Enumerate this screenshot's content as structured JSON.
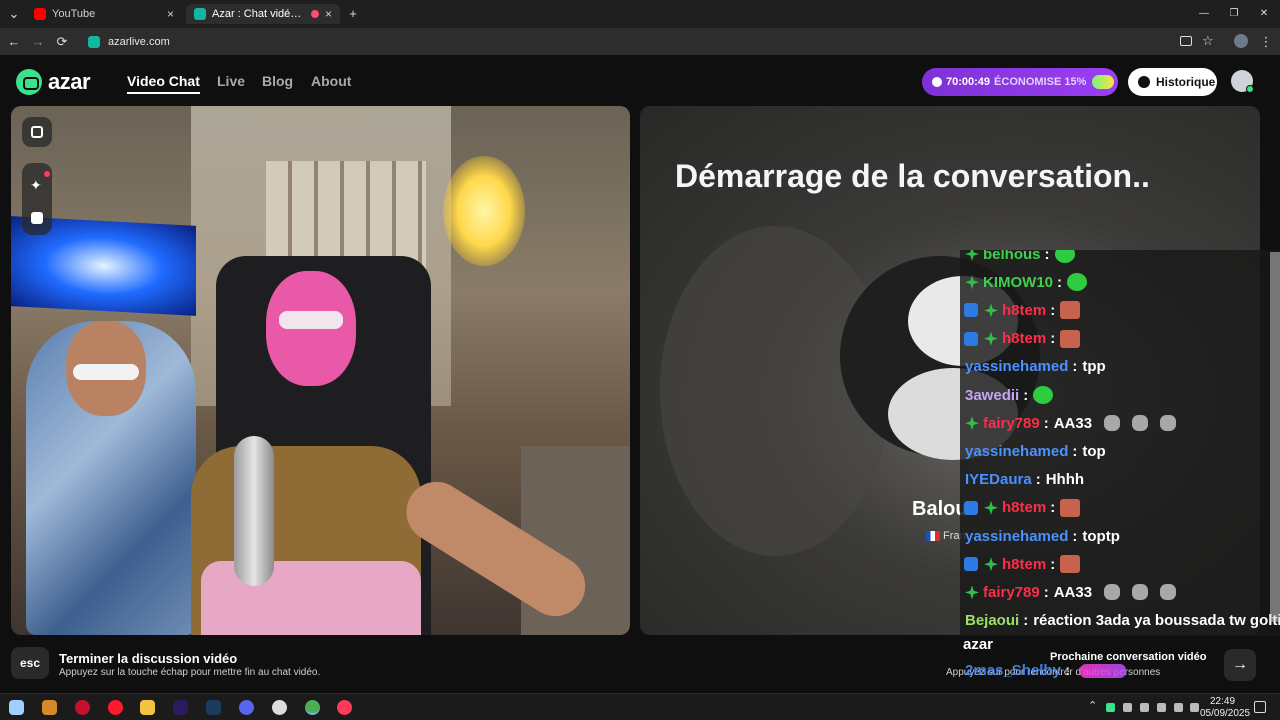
{
  "browser": {
    "tabs": [
      {
        "label": "YouTube",
        "favicon_color": "#ff0000"
      },
      {
        "label": "Azar : Chat vidéo avec de nouvelles personnes",
        "favicon_color": "#13b7a0"
      }
    ],
    "new_tab_label": "+",
    "close_glyph": "×",
    "url": "azarlive.com",
    "window_controls": {
      "minimize": "—",
      "restore": "❐",
      "close": "✕"
    },
    "nav": {
      "back": "←",
      "forward": "→",
      "reload": "⟳",
      "menu": "⋮"
    }
  },
  "site": {
    "logo_text": "azar",
    "nav": [
      "Video Chat",
      "Live",
      "Blog",
      "About"
    ],
    "promo": {
      "timer": "70:00:49",
      "label": "ÉCONOMISE 15%"
    },
    "history_label": "Historique",
    "accent_color": "#3ce28a",
    "promo_color": "#8b3be8"
  },
  "remote": {
    "status_title": "Démarrage de la conversation..",
    "peer_name": "Balou",
    "peer_country": "Fran"
  },
  "chat": [
    {
      "user": "belhous",
      "sep": ":",
      "msg": "",
      "emotes": "green",
      "badges": [
        "green"
      ],
      "color": "green"
    },
    {
      "user": "KIMOW10",
      "sep": ":",
      "msg": "",
      "emotes": "green",
      "badges": [
        "green"
      ],
      "color": "green"
    },
    {
      "user": "h8tem",
      "sep": ":",
      "msg": "",
      "emotes": "sq",
      "badges": [
        "blue",
        "green"
      ],
      "color": "red"
    },
    {
      "user": "h8tem",
      "sep": ":",
      "msg": "",
      "emotes": "sq",
      "badges": [
        "blue",
        "green"
      ],
      "color": "red"
    },
    {
      "user": "yassinehamed",
      "sep": ":",
      "msg": "tpp",
      "emotes": "",
      "badges": [],
      "color": "blue"
    },
    {
      "user": "3awedii",
      "sep": ":",
      "msg": "",
      "emotes": "green",
      "badges": [],
      "color": "lav"
    },
    {
      "user": "fairy789",
      "sep": ":",
      "msg": "AA33",
      "emotes": "fist",
      "badges": [
        "green"
      ],
      "color": "red"
    },
    {
      "user": "yassinehamed",
      "sep": ":",
      "msg": "top",
      "emotes": "",
      "badges": [],
      "color": "blue"
    },
    {
      "user": "IYEDaura",
      "sep": ":",
      "msg": "Hhhh",
      "emotes": "",
      "badges": [],
      "color": "blue"
    },
    {
      "user": "h8tem",
      "sep": ":",
      "msg": "",
      "emotes": "sq",
      "badges": [
        "blue",
        "green"
      ],
      "color": "red"
    },
    {
      "user": "yassinehamed",
      "sep": ":",
      "msg": "toptp",
      "emotes": "",
      "badges": [],
      "color": "blue"
    },
    {
      "user": "h8tem",
      "sep": ":",
      "msg": "",
      "emotes": "sq",
      "badges": [
        "blue",
        "green"
      ],
      "color": "red"
    },
    {
      "user": "fairy789",
      "sep": ":",
      "msg": "AA33",
      "emotes": "fist",
      "badges": [
        "green"
      ],
      "color": "red"
    },
    {
      "user": "Bejaoui",
      "sep": ":",
      "msg": "réaction 3ada ya boussada tw golti",
      "emotes": "",
      "badges": [],
      "color": "lime"
    }
  ],
  "chat_trailing": {
    "azar": "azar",
    "shelby_user": "2mas_Shelby",
    "shelby_sep": ":"
  },
  "bottom": {
    "esc_key": "esc",
    "end_title": "Terminer la discussion vidéo",
    "end_sub": "Appuyez sur la touche échap pour mettre fin au chat vidéo.",
    "next_title": "Prochaine conversation vidéo",
    "next_sub": "Appuyez sur pour rencontrer d'autres personnes",
    "next_arrow": "→"
  },
  "taskbar": {
    "time": "22:49",
    "date": "05/09/2025"
  }
}
